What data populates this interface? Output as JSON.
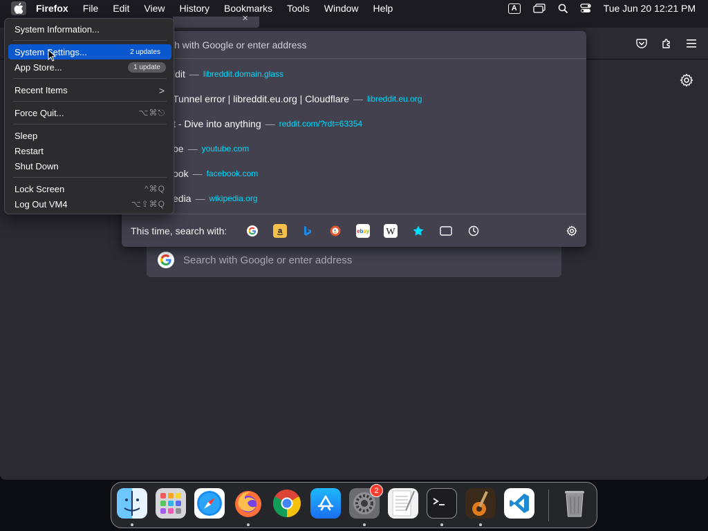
{
  "menubar": {
    "app_name": "Firefox",
    "items": [
      "File",
      "Edit",
      "View",
      "History",
      "Bookmarks",
      "Tools",
      "Window",
      "Help"
    ],
    "input_indicator": "A",
    "clock": "Tue Jun 20  12:21 PM"
  },
  "apple_menu": {
    "system_information": "System Information...",
    "system_settings": "System Settings...",
    "system_settings_badge": "2 updates",
    "app_store": "App Store...",
    "app_store_badge": "1 update",
    "recent_items": "Recent Items",
    "recent_items_arrow": ">",
    "force_quit": "Force Quit...",
    "force_quit_shortcut": "⌥⌘⎋",
    "sleep": "Sleep",
    "restart": "Restart",
    "shut_down": "Shut Down",
    "lock_screen": "Lock Screen",
    "lock_screen_shortcut": "^⌘Q",
    "log_out": "Log Out VM4",
    "log_out_shortcut": "⌥⇧⌘Q"
  },
  "urlbar": {
    "placeholder_partial": "h with Google or enter address",
    "dash": "—",
    "results": [
      {
        "title": "ldit",
        "url": "libreddit.domain.glass"
      },
      {
        "title": "Tunnel error | libreddit.eu.org | Cloudflare",
        "url": "libreddit.eu.org"
      },
      {
        "title": "t - Dive into anything",
        "url": "reddit.com/?rdt=63354"
      },
      {
        "title": "be",
        "url": "youtube.com"
      },
      {
        "title": "ook",
        "url": "facebook.com"
      },
      {
        "title": "edia",
        "url": "wikipedia.org"
      }
    ],
    "search_with_label": "This time, search with:",
    "engines": [
      "google-icon",
      "amazon-icon",
      "bing-icon",
      "duckduckgo-icon",
      "ebay-icon",
      "wikipedia-icon",
      "bookmarks-icon",
      "tabs-icon",
      "history-icon"
    ]
  },
  "newtab": {
    "search_placeholder": "Search with Google or enter address"
  },
  "dock": {
    "apps": [
      "Finder",
      "Launchpad",
      "Safari",
      "Firefox",
      "Google Chrome",
      "App Store",
      "System Settings",
      "TextEdit",
      "Terminal",
      "GarageBand",
      "Visual Studio Code",
      "Trash"
    ],
    "settings_badge": "2"
  },
  "colors": {
    "accent": "#0a58d0",
    "url_link": "#00ddff",
    "panel_bg": "#42414d",
    "window_bg": "#2b2a33"
  }
}
